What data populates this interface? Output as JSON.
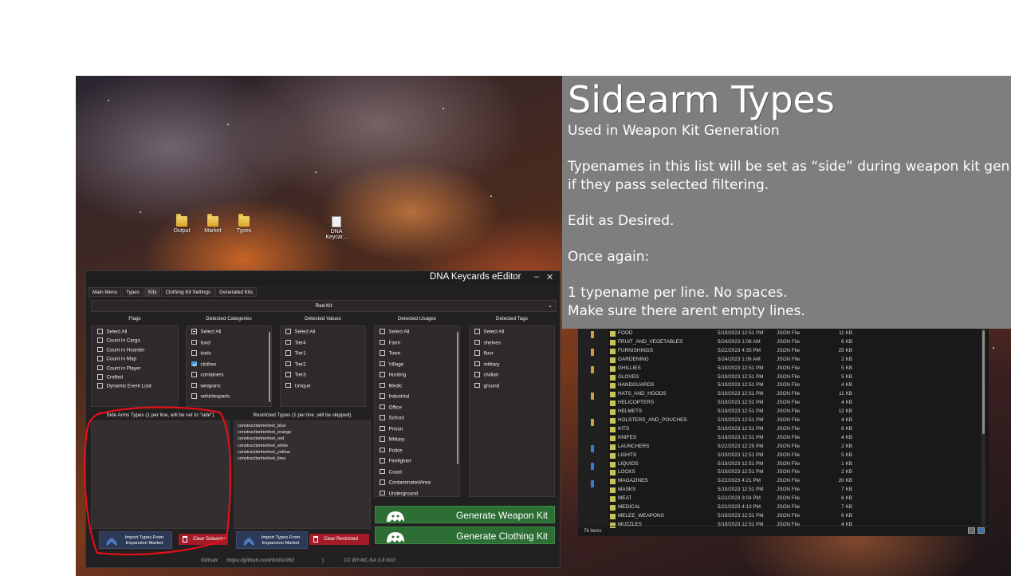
{
  "info_panel": {
    "title": "Sidearm Types",
    "subtitle": "Used in Weapon Kit Generation",
    "lines": [
      "",
      "Typenames in this list will be set as “side” during weapon kit gen",
      "if they pass selected filtering.",
      "",
      "Edit as Desired.",
      "",
      "Once again:",
      "",
      "1 typename per line. No spaces.",
      "Make sure there arent empty lines."
    ]
  },
  "desktop_icons": [
    {
      "label": "Output",
      "icon": "folder-icon"
    },
    {
      "label": "Market",
      "icon": "folder-icon"
    },
    {
      "label": "Types",
      "icon": "folder-icon"
    },
    {
      "label": "DNA Keycar...",
      "icon": "document-icon"
    }
  ],
  "explorer": {
    "files": [
      {
        "name": "FOOD",
        "date": "5/19/2023 12:51 PM",
        "type": "JSON File",
        "size": "11 KB"
      },
      {
        "name": "FRUIT_AND_VEGETABLES",
        "date": "5/24/2023 1:06 AM",
        "type": "JSON File",
        "size": "6 KB"
      },
      {
        "name": "FURNISHINGS",
        "date": "5/22/2023 4:35 PM",
        "type": "JSON File",
        "size": "25 KB"
      },
      {
        "name": "GARDENING",
        "date": "5/24/2023 1:06 AM",
        "type": "JSON File",
        "size": "2 KB"
      },
      {
        "name": "GHILLIES",
        "date": "5/19/2023 12:51 PM",
        "type": "JSON File",
        "size": "5 KB"
      },
      {
        "name": "GLOVES",
        "date": "5/19/2023 12:51 PM",
        "type": "JSON File",
        "size": "5 KB"
      },
      {
        "name": "HANDGUARDS",
        "date": "5/19/2023 12:51 PM",
        "type": "JSON File",
        "size": "4 KB"
      },
      {
        "name": "HATS_AND_HOODS",
        "date": "5/19/2023 12:51 PM",
        "type": "JSON File",
        "size": "11 KB"
      },
      {
        "name": "HELICOPTERS",
        "date": "5/19/2023 12:51 PM",
        "type": "JSON File",
        "size": "4 KB"
      },
      {
        "name": "HELMETS",
        "date": "5/19/2023 12:51 PM",
        "type": "JSON File",
        "size": "12 KB"
      },
      {
        "name": "HOLSTERS_AND_POUCHES",
        "date": "5/19/2023 12:51 PM",
        "type": "JSON File",
        "size": "4 KB"
      },
      {
        "name": "KITS",
        "date": "5/19/2023 12:51 PM",
        "type": "JSON File",
        "size": "6 KB"
      },
      {
        "name": "KNIFES",
        "date": "5/19/2023 12:51 PM",
        "type": "JSON File",
        "size": "4 KB"
      },
      {
        "name": "LAUNCHERS",
        "date": "5/22/2023 12:25 PM",
        "type": "JSON File",
        "size": "2 KB"
      },
      {
        "name": "LIGHTS",
        "date": "5/19/2023 12:51 PM",
        "type": "JSON File",
        "size": "5 KB"
      },
      {
        "name": "LIQUIDS",
        "date": "5/19/2023 12:51 PM",
        "type": "JSON File",
        "size": "1 KB"
      },
      {
        "name": "LOCKS",
        "date": "5/19/2023 12:51 PM",
        "type": "JSON File",
        "size": "2 KB"
      },
      {
        "name": "MAGAZINES",
        "date": "5/22/2023 4:21 PM",
        "type": "JSON File",
        "size": "20 KB"
      },
      {
        "name": "MASKS",
        "date": "5/19/2023 12:51 PM",
        "type": "JSON File",
        "size": "7 KB"
      },
      {
        "name": "MEAT",
        "date": "5/22/2023 3:04 PM",
        "type": "JSON File",
        "size": "6 KB"
      },
      {
        "name": "MEDICAL",
        "date": "5/22/2023 4:13 PM",
        "type": "JSON File",
        "size": "7 KB"
      },
      {
        "name": "MELEE_WEAPONS",
        "date": "5/19/2023 12:51 PM",
        "type": "JSON File",
        "size": "6 KB"
      },
      {
        "name": "MUZZLES",
        "date": "5/19/2023 12:51 PM",
        "type": "JSON File",
        "size": "4 KB"
      }
    ],
    "status": "76 items"
  },
  "editor": {
    "title": "DNA Keycards eEditor",
    "minimize": "–",
    "close": "✕",
    "tabs": [
      "Main Menu",
      "Types",
      "Kits",
      "Clothing Kit Settings",
      "Generated Kits"
    ],
    "active_tab": "Kits",
    "kit_selected": "Red Kit",
    "flags": {
      "title": "Flags",
      "items": [
        "Select All",
        "Count in Cargo",
        "Count in Hoarder",
        "Count in Map",
        "Count in Player",
        "Crafted",
        "Dynamic Event Loot"
      ]
    },
    "categories": {
      "title": "Detected Categories",
      "items": [
        "Select All",
        "food",
        "tools",
        "clothes",
        "containers",
        "weapons",
        "vehiclesparts"
      ],
      "checked": "clothes"
    },
    "values": {
      "title": "Detected Values",
      "items": [
        "Select All",
        "Tier4",
        "Tier1",
        "Tier2",
        "Tier3",
        "Unique"
      ]
    },
    "usages": {
      "title": "Detected Usages",
      "items": [
        "Select All",
        "Farm",
        "Town",
        "Village",
        "Hunting",
        "Medic",
        "Industrial",
        "Office",
        "School",
        "Prison",
        "Military",
        "Police",
        "Firefighter",
        "Coast",
        "ContaminatedArea",
        "Underground"
      ]
    },
    "tags": {
      "title": "Detected Tags",
      "items": [
        "Select All",
        "shelves",
        "floor",
        "military",
        "civilian",
        "ground"
      ]
    },
    "sidearms": {
      "title": "Side Arms Types (1 per line, will be set to \"side\")",
      "items": [],
      "import_label": "Import Types From Expansion Market",
      "clear_label": "Clear Sidearms"
    },
    "restricted": {
      "title": "Restricted Types (1 per line ,will be skipped)",
      "items": [
        "constructionhelmet_blue",
        "constructionhelmet_orange",
        "constructionhelmet_red",
        "constructionhelmet_white",
        "constructionhelmet_yellow",
        "constructionhelmet_lime"
      ],
      "import_label": "Import Types From Expansion Market",
      "clear_label": "Clear Restricted"
    },
    "generate_weapon": "Generate Weapon Kit",
    "generate_clothing": "Generate Clothing Kit",
    "footer": {
      "github_label": "Github:",
      "github_url": "https://github.com/Gh0st352",
      "separator": "|",
      "license": "CC BY-NC-SA 3.0 IGO"
    }
  },
  "colors": {
    "info_panel_bg": "#7e7e7e",
    "editor_bg": "#232021",
    "generate_green": "#2c6e34",
    "clear_red": "#a21b27",
    "import_blue": "#2c3a57",
    "annotation_red": "#e0101a"
  }
}
